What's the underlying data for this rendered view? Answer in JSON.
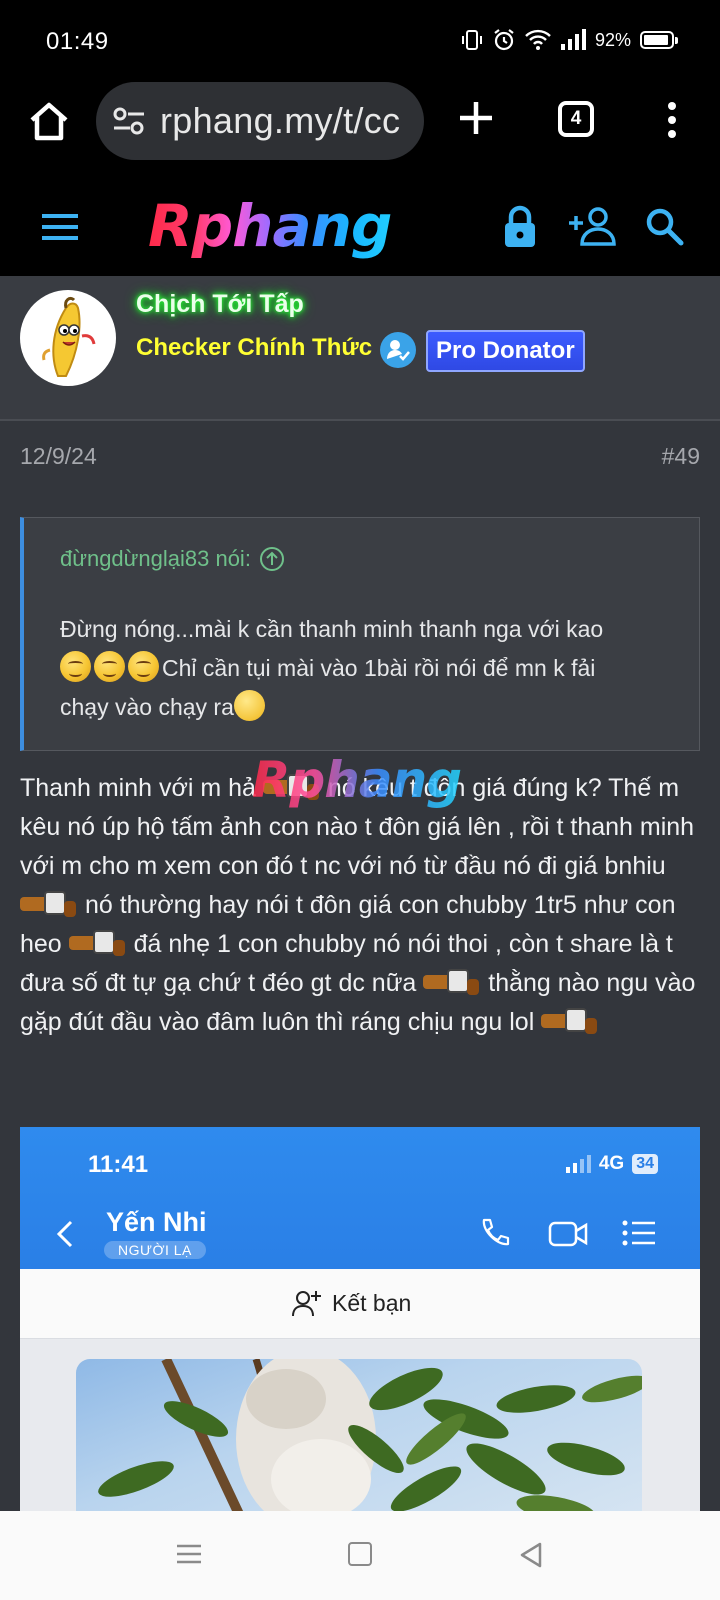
{
  "status_bar": {
    "time": "01:49",
    "battery": "92%",
    "battery_level": 0.92
  },
  "browser": {
    "url": "rphang.my/t/cc",
    "tab_count": "4"
  },
  "site": {
    "logo_text": "Rphang"
  },
  "user": {
    "name": "Chịch Tới Tấp",
    "title": "Checker Chính Thức",
    "badge": "Pro Donator"
  },
  "post": {
    "date": "12/9/24",
    "number": "#49",
    "quote": {
      "author": "đừngdừnglại83 nói:",
      "line1": "Đừng nóng...mài k cần thanh minh thanh nga với kao",
      "line2": "Chỉ cần tụi mài vào 1bài rồi nói để mn k fải",
      "line3": "chạy vào chạy ra"
    },
    "body": {
      "p1": "Thanh minh với m hả",
      "p2": " nó kêu t đôn giá đúng k? Thế m kêu nó úp hộ tấm ảnh con nào t đôn giá lên , rồi t thanh minh với m cho m xem con đó t nc với nó từ đầu nó đi giá bnhiu",
      "p3": " nó thường hay nói t đôn giá con chubby 1tr5 như con heo",
      "p4": " đá nhẹ 1 con chubby nó nói thoi , còn t share là t đưa số đt tự gạ chứ t đéo gt dc nữa",
      "p5": " thằng nào ngu vào gặp đút đầu vào đâm luôn thì ráng chịu ngu lol"
    },
    "watermark": "Rphang"
  },
  "embedded_screenshot": {
    "time": "11:41",
    "network": "4G",
    "battery": "34",
    "contact_name": "Yến Nhi",
    "contact_tag": "NGƯỜI LẠ",
    "add_friend": "Kết bạn"
  },
  "colors": {
    "background": "#32353b",
    "username_glow": "#2bff3a",
    "user_title": "#ffff33",
    "badge": "#3b5bff",
    "quote_border": "#3d8ee0",
    "quote_author": "#6fc08a",
    "zalo_blue": "#2a7fe6"
  }
}
